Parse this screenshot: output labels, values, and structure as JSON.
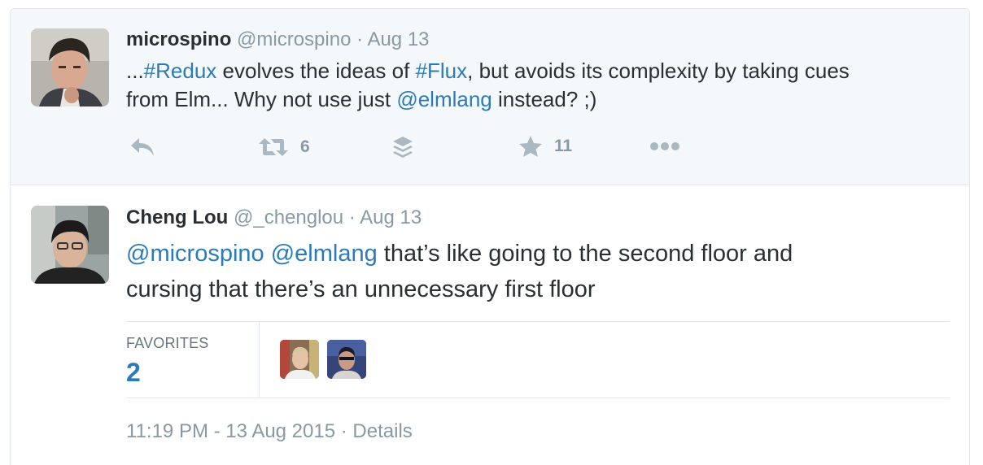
{
  "parent_tweet": {
    "name": "microspino",
    "handle": "@microspino",
    "separator": "·",
    "date": "Aug 13",
    "text_part1": "...",
    "hashtag1": "#Redux",
    "text_part2": " evolves the ideas of ",
    "hashtag2": "#Flux",
    "text_part3": ", but avoids its complexity by taking cues",
    "text_part4": "from Elm... Why not use just ",
    "mention": "@elmlang",
    "text_part5": " instead? ;)",
    "retweet_count": "6",
    "favorite_count": "11",
    "icons": [
      "reply-icon",
      "retweet-icon",
      "buffer-icon",
      "star-icon",
      "more-icon"
    ]
  },
  "reply_tweet": {
    "name": "Cheng Lou",
    "handle": "@_chenglou",
    "separator": "·",
    "date": "Aug 13",
    "mention1": "@microspino",
    "mention2": "@elmlang",
    "text_line1": " that’s like going to the second floor and",
    "text_line2": "cursing that there’s an unnecessary first floor",
    "favorites_label": "FAVORITES",
    "favorites_count": "2",
    "timestamp": "11:19 PM - 13 Aug 2015",
    "details_separator": "·",
    "details_link": "Details"
  },
  "colors": {
    "link": "#2b7bb9",
    "muted": "#8899a6",
    "text": "#292f33",
    "parent_bg": "#f5f8fa",
    "border": "#e1e8ed"
  }
}
